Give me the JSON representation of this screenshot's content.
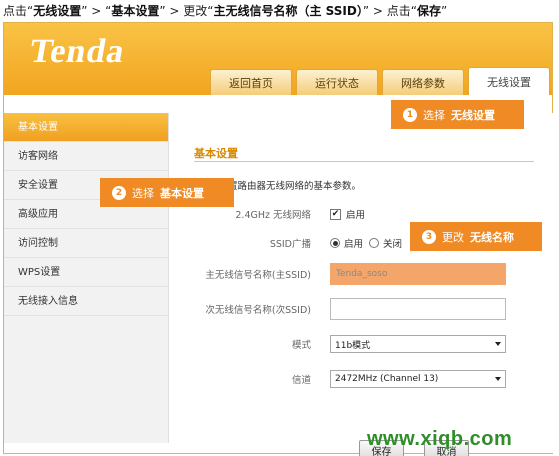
{
  "instruction": {
    "t1": "点击“",
    "b1": "无线设置",
    "t2": "”  >  “",
    "b2": "基本设置",
    "t3": "”  >  更改“",
    "b3": "主无线信号名称（主 SSID）",
    "t4": "”  >  点击“",
    "b4": "保存",
    "t5": "”"
  },
  "header": {
    "logo": "Tenda",
    "tabs": [
      "返回首页",
      "运行状态",
      "网络参数",
      "无线设置"
    ],
    "active_tab": "无线设置"
  },
  "sidebar": {
    "items": [
      "基本设置",
      "访客网络",
      "安全设置",
      "高级应用",
      "访问控制",
      "WPS设置",
      "无线接入信息"
    ],
    "active": "基本设置"
  },
  "main": {
    "title": "基本设置",
    "description": "置路由器无线网络的基本参数。",
    "wifi_label": "2.4GHz 无线网络",
    "wifi_enable": "启用",
    "wifi_enabled": true,
    "ssid_broadcast_label": "SSID广播",
    "ssid_broadcast_on": "启用",
    "ssid_broadcast_off": "关闭",
    "ssid_broadcast_value": "启用",
    "primary_ssid_label": "主无线信号名称(主SSID)",
    "primary_ssid_value": "Tenda_soso",
    "secondary_ssid_label": "次无线信号名称(次SSID)",
    "secondary_ssid_value": "",
    "mode_label": "模式",
    "mode_value": "11b模式",
    "channel_label": "信道",
    "channel_value": "2472MHz (Channel 13)",
    "save_label": "保存",
    "cancel_label": "取消"
  },
  "callouts": {
    "c1": {
      "num": "1",
      "text": "选择",
      "strong": "无线设置"
    },
    "c2": {
      "num": "2",
      "text": "选择",
      "strong": "基本设置"
    },
    "c3": {
      "num": "3",
      "text": "更改",
      "strong": "无线名称"
    }
  },
  "watermark": "www.xiqb.com",
  "colors": {
    "brand_orange": "#f2a51f",
    "callout_orange": "#ef8a24",
    "highlight_field": "#f4a66a",
    "watermark_green": "#2f8d2a"
  }
}
